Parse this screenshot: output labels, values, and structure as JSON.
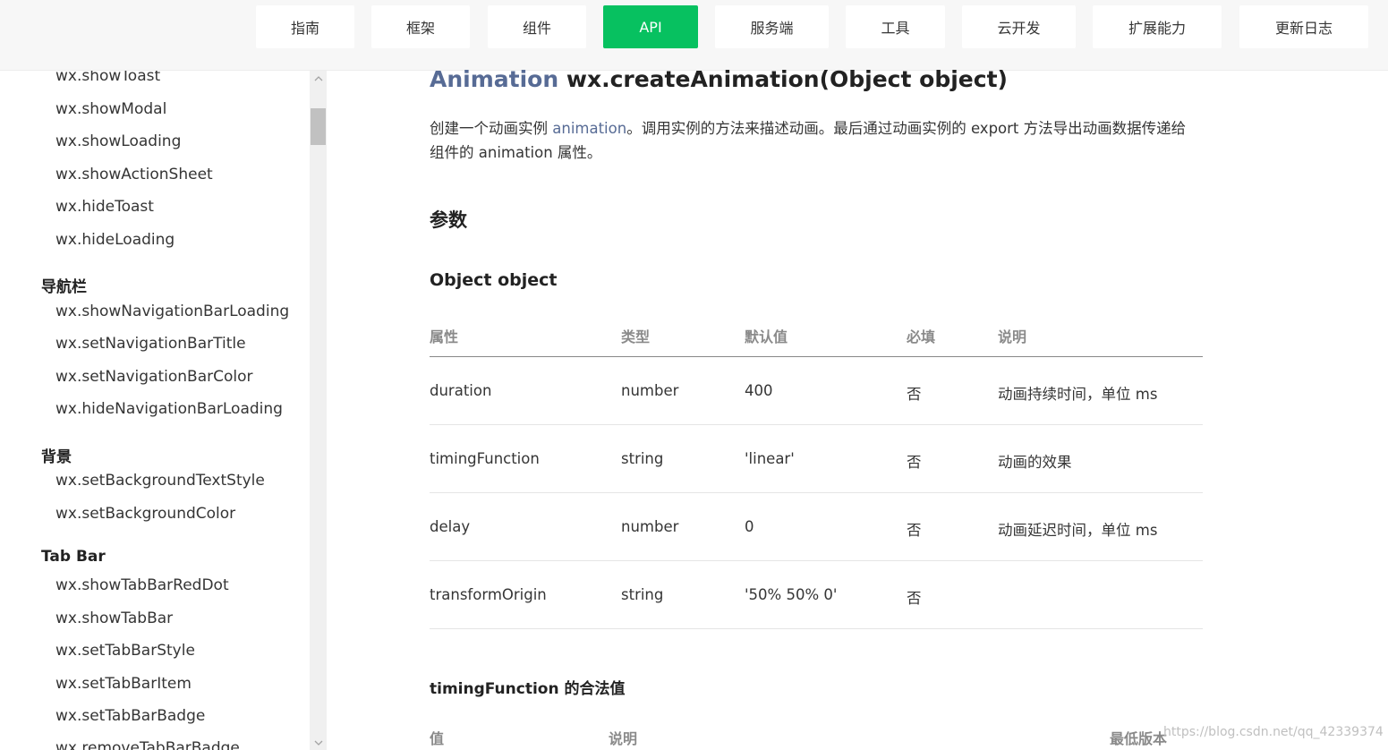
{
  "topnav": {
    "tabs": [
      {
        "label": "指南"
      },
      {
        "label": "框架"
      },
      {
        "label": "组件"
      },
      {
        "label": "API"
      },
      {
        "label": "服务端"
      },
      {
        "label": "工具"
      },
      {
        "label": "云开发"
      },
      {
        "label": "扩展能力"
      },
      {
        "label": "更新日志"
      }
    ],
    "active_tab": "API",
    "active_color": "#07c160"
  },
  "sidebar": {
    "items_top": [
      "wx.showToast",
      "wx.showModal",
      "wx.showLoading",
      "wx.showActionSheet",
      "wx.hideToast",
      "wx.hideLoading"
    ],
    "group_nav": "导航栏",
    "items_nav": [
      "wx.showNavigationBarLoading",
      "wx.setNavigationBarTitle",
      "wx.setNavigationBarColor",
      "wx.hideNavigationBarLoading"
    ],
    "group_bg": "背景",
    "items_bg": [
      "wx.setBackgroundTextStyle",
      "wx.setBackgroundColor"
    ],
    "group_tabbar": "Tab Bar",
    "items_tabbar": [
      "wx.showTabBarRedDot",
      "wx.showTabBar",
      "wx.setTabBarStyle",
      "wx.setTabBarItem",
      "wx.setTabBarBadge",
      "wx.removeTabBarBadge"
    ]
  },
  "main": {
    "title_type": "Animation",
    "title_func": "wx.createAnimation(Object object)",
    "desc_pre": "创建一个动画实例 ",
    "desc_link": "animation",
    "desc_post": "。调用实例的方法来描述动画。最后通过动画实例的 export 方法导出动画数据传递给组件的 animation 属性。",
    "params_heading": "参数",
    "object_heading": "Object object",
    "table": {
      "headers": [
        "属性",
        "类型",
        "默认值",
        "必填",
        "说明"
      ],
      "rows": [
        [
          "duration",
          "number",
          "400",
          "否",
          "动画持续时间，单位 ms"
        ],
        [
          "timingFunction",
          "string",
          "'linear'",
          "否",
          "动画的效果"
        ],
        [
          "delay",
          "number",
          "0",
          "否",
          "动画延迟时间，单位 ms"
        ],
        [
          "transformOrigin",
          "string",
          "'50% 50% 0'",
          "否",
          ""
        ]
      ]
    },
    "timing_heading": "timingFunction 的合法值",
    "table2": {
      "headers": [
        "值",
        "说明",
        "最低版本"
      ]
    }
  },
  "watermark": "https://blog.csdn.net/qq_42339374"
}
